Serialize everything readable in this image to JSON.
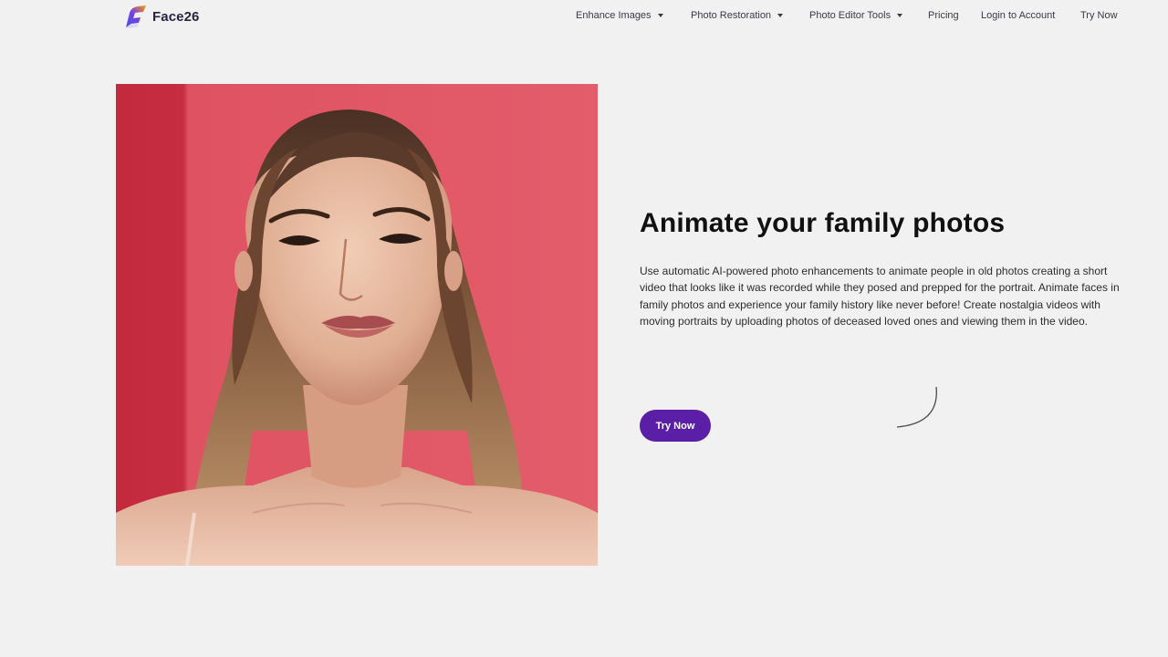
{
  "brand": {
    "name": "Face26",
    "logo_icon": "feather-logo-icon",
    "accent": "#5a1fa6"
  },
  "nav": {
    "items": [
      {
        "label": "Enhance Images",
        "has_dropdown": true
      },
      {
        "label": "Photo Restoration",
        "has_dropdown": true
      },
      {
        "label": "Photo Editor Tools",
        "has_dropdown": true
      },
      {
        "label": "Pricing",
        "has_dropdown": false
      },
      {
        "label": "Login to Account",
        "has_dropdown": false
      },
      {
        "label": "Try Now",
        "has_dropdown": false
      }
    ]
  },
  "hero": {
    "image_icon": "portrait-photo",
    "title": "Animate your family photos",
    "description": "Use automatic AI-powered photo enhancements to animate people in old photos creating a short video that looks like it was recorded while they posed and prepped for the portrait. Animate faces in family photos and experience your family history like never before! Create nostalgia videos with moving portraits by uploading photos of deceased loved ones and viewing them in the video.",
    "cta_label": "Try Now",
    "loading_icon": "loading-spinner-icon"
  },
  "colors": {
    "background": "#f1f1f1",
    "photo_backdrop": "#e05664",
    "button": "#5a1fa6"
  }
}
